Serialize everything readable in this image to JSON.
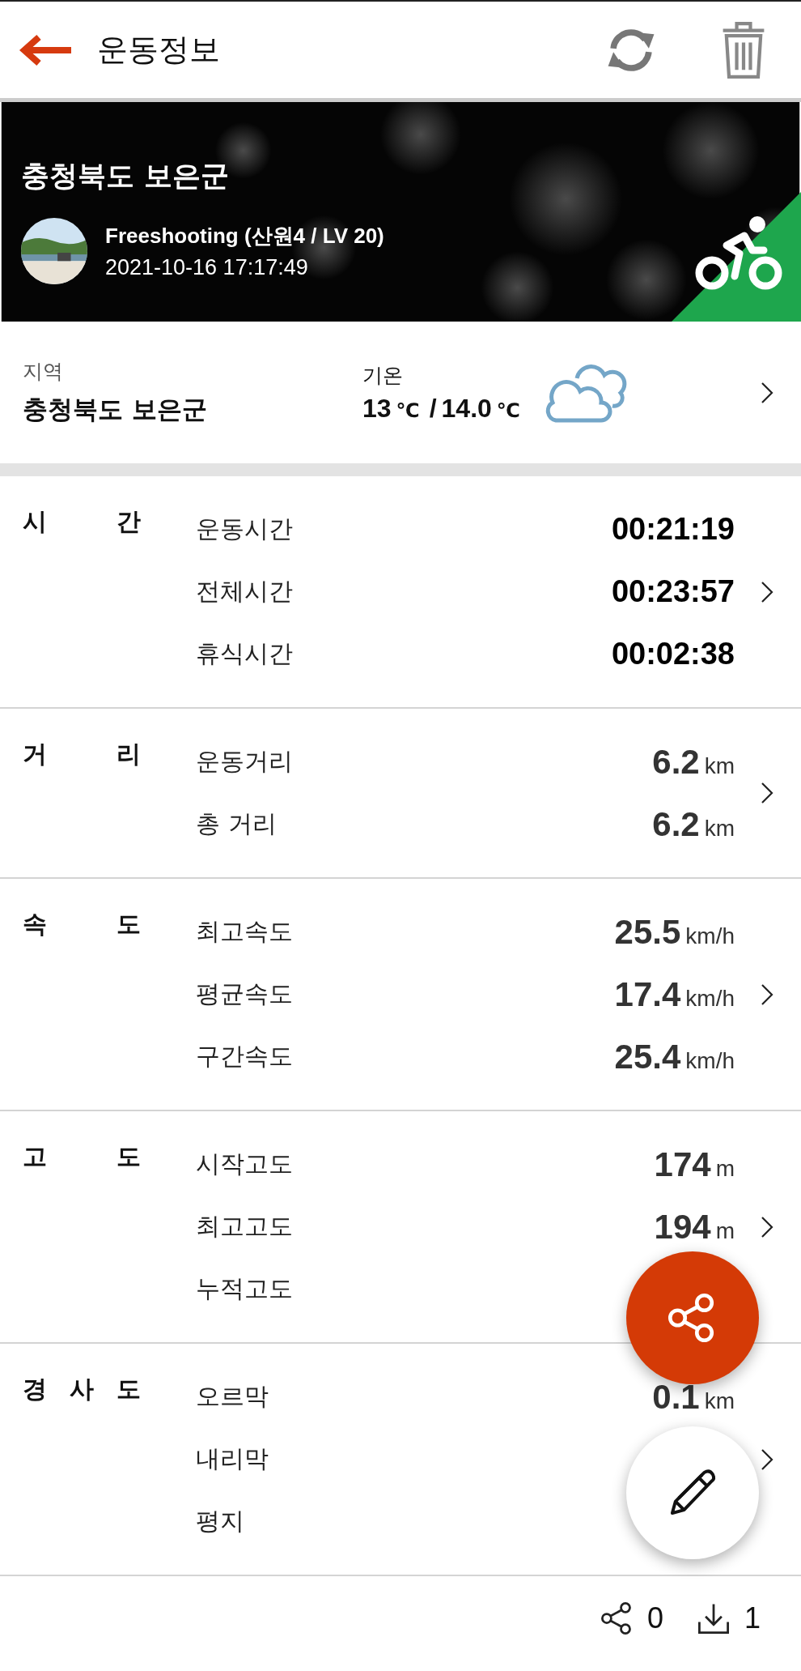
{
  "header": {
    "title": "운동정보"
  },
  "banner": {
    "region": "충청북도 보은군",
    "user": "Freeshooting (산원4 / LV 20)",
    "datetime": "2021-10-16 17:17:49"
  },
  "weather": {
    "area_label": "지역",
    "area": "충청북도 보은군",
    "temp_label": "기온",
    "temp_low": "13",
    "temp_unit_1": "℃",
    "temp_sep": "/",
    "temp_high": "14.0",
    "temp_unit_2": "℃"
  },
  "sections": [
    {
      "label": "시 간",
      "rows": [
        {
          "name": "운동시간",
          "value": "00:21:19",
          "kind": "time"
        },
        {
          "name": "전체시간",
          "value": "00:23:57",
          "kind": "time"
        },
        {
          "name": "휴식시간",
          "value": "00:02:38",
          "kind": "time"
        }
      ]
    },
    {
      "label": "거 리",
      "rows": [
        {
          "name": "운동거리",
          "value": "6.2",
          "unit": "km",
          "kind": "measure"
        },
        {
          "name": "총 거리",
          "value": "6.2",
          "unit": "km",
          "kind": "measure"
        }
      ]
    },
    {
      "label": "속 도",
      "rows": [
        {
          "name": "최고속도",
          "value": "25.5",
          "unit": "km/h",
          "kind": "measure"
        },
        {
          "name": "평균속도",
          "value": "17.4",
          "unit": "km/h",
          "kind": "measure"
        },
        {
          "name": "구간속도",
          "value": "25.4",
          "unit": "km/h",
          "kind": "measure"
        }
      ]
    },
    {
      "label": "고 도",
      "rows": [
        {
          "name": "시작고도",
          "value": "174",
          "unit": "m",
          "kind": "measure"
        },
        {
          "name": "최고고도",
          "value": "194",
          "unit": "m",
          "kind": "measure"
        },
        {
          "name": "누적고도",
          "kind": "hidden"
        }
      ]
    },
    {
      "label": "경 사 도",
      "rows": [
        {
          "name": "오르막",
          "value": "0.1",
          "unit": "km",
          "kind": "measure"
        },
        {
          "name": "내리막",
          "kind": "hidden"
        },
        {
          "name": "평지",
          "kind": "hidden"
        }
      ]
    }
  ],
  "footer": {
    "shares": "0",
    "downloads": "1"
  }
}
